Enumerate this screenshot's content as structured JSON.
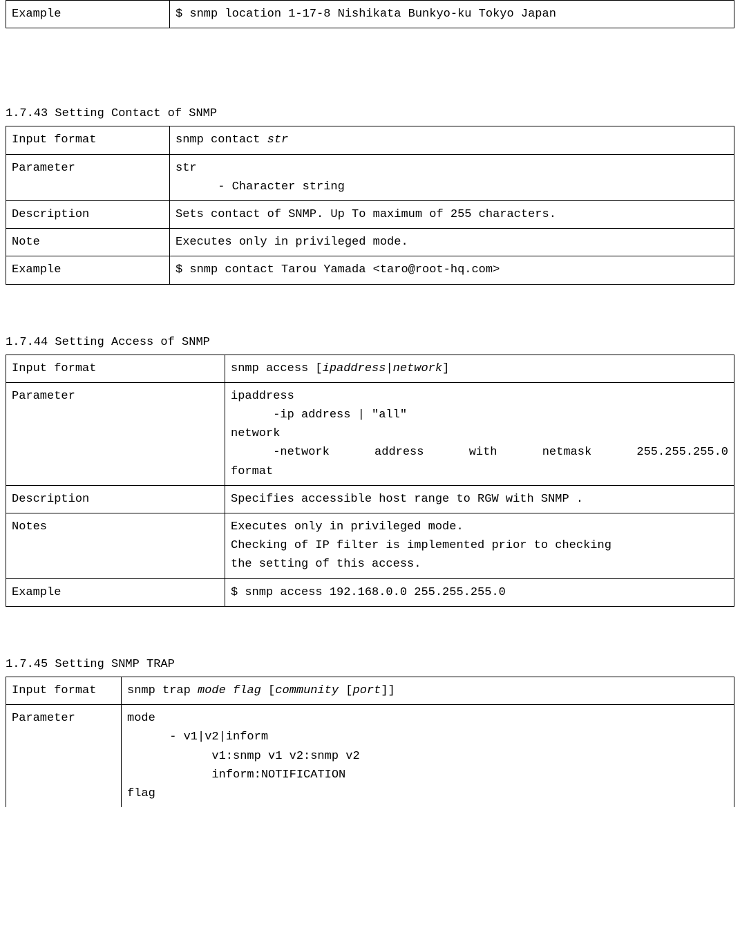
{
  "sec0": {
    "rows": {
      "example_label": "Example",
      "example_value": "$ snmp location 1-17-8 Nishikata Bunkyo-ku Tokyo Japan"
    }
  },
  "sec1": {
    "heading": "1.7.43 Setting Contact of SNMP",
    "rows": {
      "input_label": "Input format",
      "input_value_pre": "snmp contact ",
      "input_value_italic": "str",
      "param_label": "Parameter",
      "param_l1": "str",
      "param_l2": "- Character string",
      "desc_label": "Description",
      "desc_value": "Sets contact of SNMP. Up To maximum of 255 characters.",
      "note_label": "Note",
      "note_value": "Executes only in privileged mode.",
      "example_label": "Example",
      "example_value": "$ snmp contact Tarou Yamada <taro@root-hq.com>"
    }
  },
  "sec2": {
    "heading": "1.7.44 Setting Access of SNMP",
    "rows": {
      "input_label": "Input format",
      "input_value_pre": "snmp access [",
      "input_value_italic": "ipaddress|network",
      "input_value_post": "]",
      "param_label": "Parameter",
      "param_l1": "ipaddress",
      "param_l2": "-ip address | \"all\"",
      "param_l3": "network",
      "param_l4": "-network  address  with  netmask  255.255.255.0",
      "param_l5": "format",
      "desc_label": "Description",
      "desc_value": "Specifies accessible host range to RGW with SNMP .",
      "notes_label": "Notes",
      "notes_l1": "Executes only in privileged mode.",
      "notes_l2": "Checking of IP filter is implemented prior to checking",
      "notes_l3": "the setting of this access.",
      "example_label": "Example",
      "example_value": "$ snmp access 192.168.0.0 255.255.255.0"
    }
  },
  "sec3": {
    "heading": "1.7.45 Setting SNMP TRAP",
    "rows": {
      "input_label": "Input format",
      "input_value_pre": "snmp trap ",
      "input_value_italic1": "mode flag",
      "input_value_mid": " [",
      "input_value_italic2": "community",
      "input_value_mid2": " [",
      "input_value_italic3": "port",
      "input_value_post": "]]",
      "param_label": "Parameter",
      "param_l1": "mode",
      "param_l2": "- v1|v2|inform",
      "param_l3": "v1:snmp v1 v2:snmp v2",
      "param_l4": "inform:NOTIFICATION",
      "param_l5": "flag"
    }
  }
}
